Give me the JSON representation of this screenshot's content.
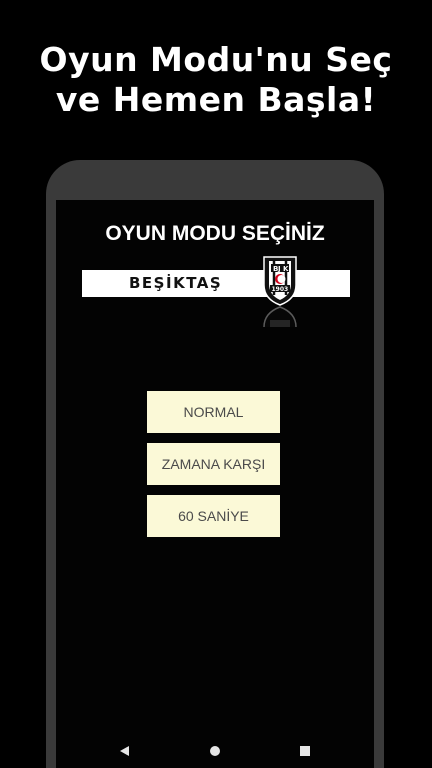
{
  "promo": {
    "headline_line1": "Oyun Modu'nu Seç",
    "headline_line2": "ve Hemen Başla!"
  },
  "screen": {
    "title": "OYUN MODU SEÇİNİZ",
    "team_name": "BEŞİKTAŞ",
    "crest_letters": [
      "B",
      "J",
      "K"
    ],
    "crest_year": "1903",
    "modes": [
      {
        "label": "NORMAL"
      },
      {
        "label": "ZAMANA KARŞI"
      },
      {
        "label": "60 SANİYE"
      }
    ]
  },
  "navbar": {
    "back_icon": "back-triangle-icon",
    "home_icon": "home-circle-icon",
    "recents_icon": "recents-square-icon"
  },
  "colors": {
    "background": "#000000",
    "phone_frame": "#3a3a3a",
    "screen": "#030303",
    "button_bg": "#fbf9d7",
    "button_text": "#4b4b4b",
    "banner": "#ffffff"
  }
}
